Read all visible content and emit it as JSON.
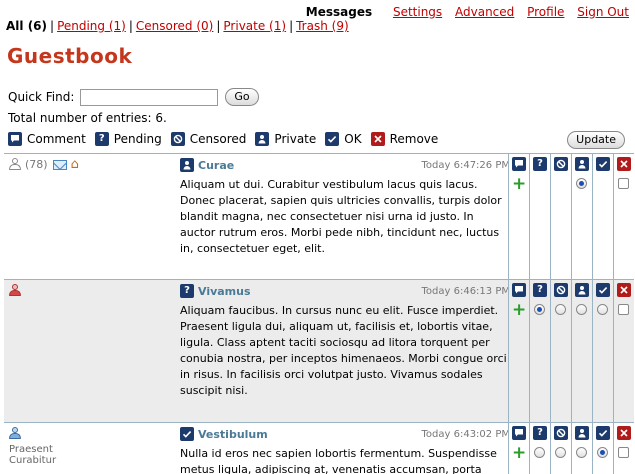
{
  "filters": {
    "all": "All (6)",
    "pending": "Pending (1)",
    "censored": "Censored (0)",
    "private": "Private (1)",
    "trash": "Trash (9)",
    "sep": "|"
  },
  "nav": {
    "messages": "Messages",
    "settings": "Settings",
    "advanced": "Advanced",
    "profile": "Profile",
    "signout": "Sign Out"
  },
  "title": "Guestbook",
  "quickfind": {
    "label": "Quick Find:",
    "value": "",
    "placeholder": "",
    "go": "Go"
  },
  "total": "Total number of entries: 6.",
  "legend": {
    "comment": "Comment",
    "pending": "Pending",
    "censored": "Censored",
    "private": "Private",
    "ok": "OK",
    "remove": "Remove"
  },
  "update_label": "Update",
  "icons": {
    "comment": "speech-bubble-icon",
    "pending": "question-mark-icon",
    "censored": "no-entry-icon",
    "private": "user-icon",
    "ok": "checkmark-icon",
    "remove": "x-icon"
  },
  "colors": {
    "brand": "#c5371c",
    "link": "#c00000",
    "icon_navy": "#1c3a6b",
    "icon_red": "#b01b1b",
    "subject": "#4a7a96"
  },
  "entries": [
    {
      "count": "(78)",
      "author": "",
      "subject": "Curae",
      "status": "private",
      "time": "Today 6:47:26 PM",
      "text": "Aliquam ut dui. Curabitur vestibulum lacus quis lacus. Donec placerat, sapien quis ultricies convallis, turpis dolor blandit magna, nec consectetuer nisi urna id justo. In auctor rutrum eros. Morbi pede nibh, tincidunt nec, luctus in, consectetuer eget, elit."
    },
    {
      "count": "",
      "author": "",
      "subject": "Vivamus",
      "status": "pending",
      "time": "Today 6:46:13 PM",
      "text": "Aliquam faucibus. In cursus nunc eu elit. Fusce imperdiet. Praesent ligula dui, aliquam ut, facilisis et, lobortis vitae, ligula. Class aptent taciti sociosqu ad litora torquent per conubia nostra, per inceptos himenaeos. Morbi congue orci in risus. In facilisis orci volutpat justo. Vivamus sodales suscipit nisi."
    },
    {
      "count": "",
      "author": "Praesent Curabitur",
      "subject": "Vestibulum",
      "status": "ok",
      "time": "Today 6:43:02 PM",
      "text": "Nulla id eros nec sapien lobortis fermentum. Suspendisse metus ligula, adipiscing at, venenatis accumsan, porta"
    }
  ]
}
